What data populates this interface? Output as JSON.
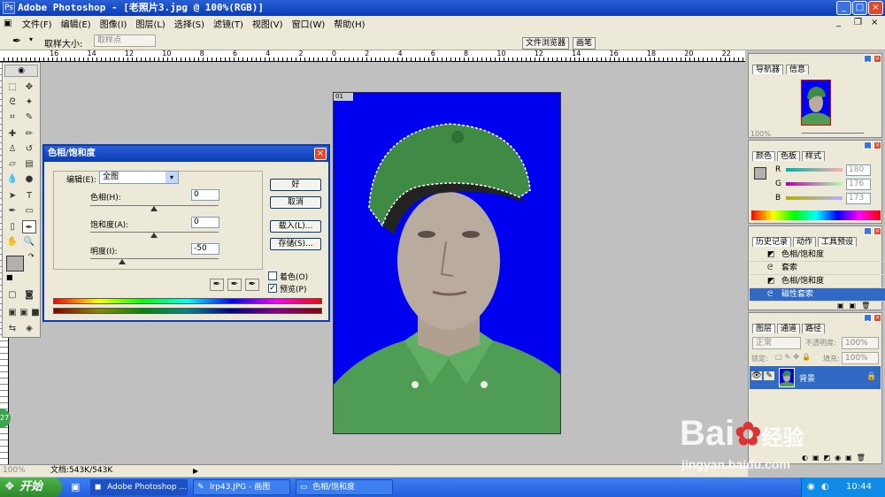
{
  "window": {
    "title": "Adobe Photoshop - [老照片3.jpg @ 100%(RGB)]",
    "icon": "photoshop-icon",
    "controls": [
      "_",
      "□",
      "×"
    ]
  },
  "menu": [
    "文件(F)",
    "编辑(E)",
    "图像(I)",
    "图层(L)",
    "选择(S)",
    "滤镜(T)",
    "视图(V)",
    "窗口(W)",
    "帮助(H)"
  ],
  "options_bar": {
    "sample_size_label": "取样大小:",
    "sample_size_value": "取样点",
    "palette_tabs": [
      "文件浏览器",
      "画笔"
    ]
  },
  "ruler_numbers": [
    "16",
    "14",
    "12",
    "10",
    "8",
    "6",
    "4",
    "2",
    "0",
    "2",
    "4",
    "6",
    "8",
    "10",
    "12",
    "14",
    "16",
    "18",
    "20",
    "22"
  ],
  "canvas_badge": "01",
  "dialog": {
    "title": "色相/饱和度",
    "edit_label": "编辑(E):",
    "edit_value": "全图",
    "hue_label": "色相(H):",
    "hue_value": "0",
    "saturation_label": "饱和度(A):",
    "saturation_value": "0",
    "lightness_label": "明度(I):",
    "lightness_value": "-50",
    "ok": "好",
    "cancel": "取消",
    "load": "载入(L)...",
    "save": "存储(S)...",
    "colorize_label": "着色(O)",
    "colorize_checked": false,
    "preview_label": "预览(P)",
    "preview_checked": true
  },
  "navigator": {
    "tabs": [
      "导航器",
      "信息"
    ],
    "zoom": "100%"
  },
  "color_panel": {
    "tabs": [
      "颜色",
      "色板",
      "样式"
    ],
    "channels": [
      {
        "label": "R",
        "value": "180"
      },
      {
        "label": "G",
        "value": "176"
      },
      {
        "label": "B",
        "value": "173"
      }
    ]
  },
  "history_panel": {
    "tabs": [
      "历史记录",
      "动作",
      "工具预设"
    ],
    "items": [
      {
        "label": "色相/饱和度",
        "icon": "adjustment-icon",
        "active": false
      },
      {
        "label": "套索",
        "icon": "lasso-icon",
        "active": false
      },
      {
        "label": "色相/饱和度",
        "icon": "adjustment-icon",
        "active": false
      },
      {
        "label": "磁性套索",
        "icon": "magnetic-lasso-icon",
        "active": true
      }
    ]
  },
  "layers_panel": {
    "tabs": [
      "图层",
      "通道",
      "路径"
    ],
    "blend_mode": "正常",
    "opacity_label": "不透明度:",
    "opacity_value": "100%",
    "lock_label": "锁定:",
    "fill_label": "填充:",
    "fill_value": "100%",
    "layer_name": "背景"
  },
  "status_bar": {
    "zoom": "100%",
    "doc_info": "文档:543K/543K"
  },
  "taskbar": {
    "start": "开始",
    "tasks": [
      {
        "label": "Adobe Photoshop ...",
        "active": true
      },
      {
        "label": "lrp43.JPG - 画图",
        "active": false
      },
      {
        "label": "色相/饱和度",
        "active": false
      }
    ],
    "clock": "10:44"
  },
  "watermark": {
    "brand": "Bai",
    "brand_cn": "经验",
    "url": "jingyan.baidu.com"
  },
  "colors": {
    "titlebar": "#0a3bb5",
    "canvas_bg": "#0000f0",
    "foreground_swatch": "#b4b0ad",
    "background_swatch": "#0000f0",
    "selection": "#316ac5"
  }
}
